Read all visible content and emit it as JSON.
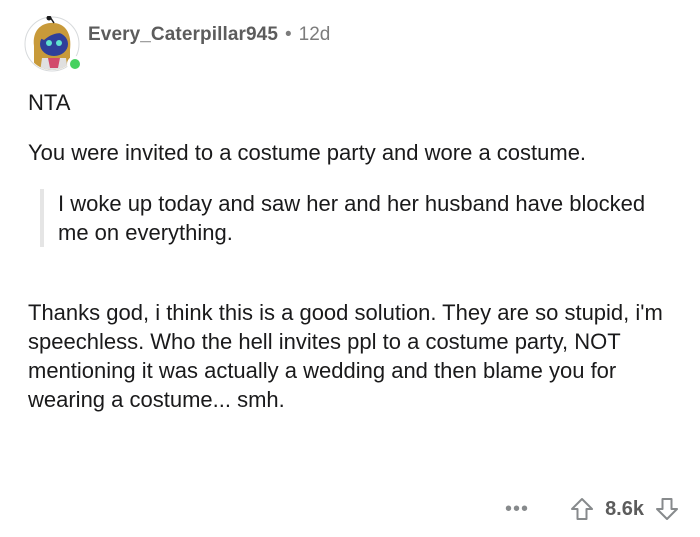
{
  "comment": {
    "author": "Every_Caterpillar945",
    "separator": "•",
    "age": "12d",
    "avatar_icon": "snoo-avatar-icon",
    "online_status_color": "#46d160",
    "paragraphs": {
      "nta": "NTA",
      "main": "You were invited to a costume party and wore a costume.",
      "quote": "I woke up today and saw her and her husband have blocked me on everything.",
      "thanks": "Thanks god, i think this is a good solution. They are so stupid, i'm speechless. Who the hell invites ppl to a costume party, NOT mentioning it was actually a wedding and then blame you for wearing a costume... smh."
    },
    "actions": {
      "more_label": "•••",
      "upvote_icon": "upvote-arrow-icon",
      "score": "8.6k",
      "downvote_icon": "downvote-arrow-icon"
    }
  }
}
